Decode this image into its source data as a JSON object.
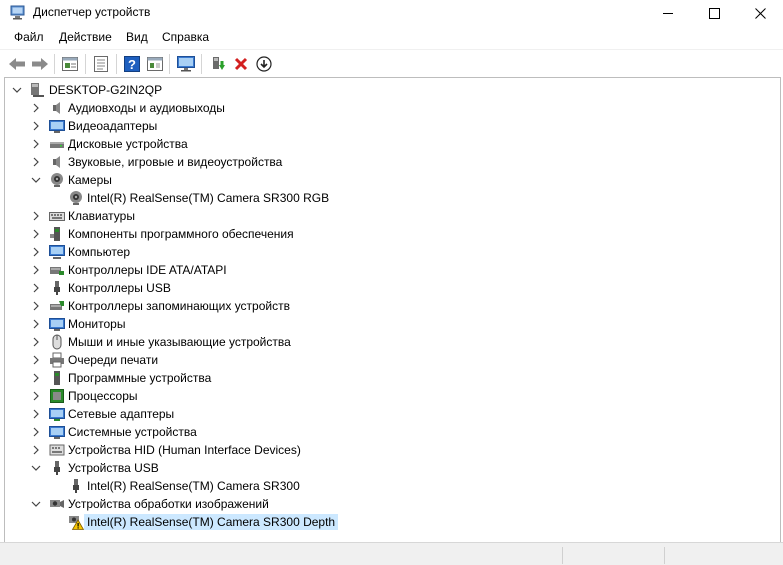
{
  "window": {
    "title": "Диспетчер устройств",
    "icon": "device-manager-icon"
  },
  "menu": [
    "Файл",
    "Действие",
    "Вид",
    "Справка"
  ],
  "toolbar": {
    "buttons": [
      "back-icon",
      "forward-icon",
      "properties-view-icon",
      "document-icon",
      "help-icon",
      "grid-view-icon",
      "monitor-scan-icon",
      "update-driver-icon",
      "uninstall-icon",
      "download-icon"
    ]
  },
  "tree": {
    "root": "DESKTOP-G2IN2QP",
    "items": [
      {
        "label": "Аудиовходы и аудиовыходы",
        "icon": "audio-icon",
        "expanded": false
      },
      {
        "label": "Видеоадаптеры",
        "icon": "display-adapter-icon",
        "expanded": false
      },
      {
        "label": "Дисковые устройства",
        "icon": "disk-icon",
        "expanded": false
      },
      {
        "label": "Звуковые, игровые и видеоустройства",
        "icon": "speaker-icon",
        "expanded": false
      },
      {
        "label": "Камеры",
        "icon": "camera-icon",
        "expanded": true
      },
      {
        "label": "Intel(R) RealSense(TM) Camera SR300 RGB",
        "icon": "camera-icon",
        "child": true
      },
      {
        "label": "Клавиатуры",
        "icon": "keyboard-icon",
        "expanded": false
      },
      {
        "label": "Компоненты программного обеспечения",
        "icon": "software-component-icon",
        "expanded": false
      },
      {
        "label": "Компьютер",
        "icon": "computer-icon",
        "expanded": false
      },
      {
        "label": "Контроллеры IDE ATA/ATAPI",
        "icon": "ide-controller-icon",
        "expanded": false
      },
      {
        "label": "Контроллеры USB",
        "icon": "usb-icon",
        "expanded": false
      },
      {
        "label": "Контроллеры запоминающих устройств",
        "icon": "storage-controller-icon",
        "expanded": false
      },
      {
        "label": "Мониторы",
        "icon": "monitor-icon",
        "expanded": false
      },
      {
        "label": "Мыши и иные указывающие устройства",
        "icon": "mouse-icon",
        "expanded": false
      },
      {
        "label": "Очереди печати",
        "icon": "printer-icon",
        "expanded": false
      },
      {
        "label": "Программные устройства",
        "icon": "software-device-icon",
        "expanded": false
      },
      {
        "label": "Процессоры",
        "icon": "processor-icon",
        "expanded": false
      },
      {
        "label": "Сетевые адаптеры",
        "icon": "network-adapter-icon",
        "expanded": false
      },
      {
        "label": "Системные устройства",
        "icon": "system-device-icon",
        "expanded": false
      },
      {
        "label": "Устройства HID (Human Interface Devices)",
        "icon": "hid-icon",
        "expanded": false
      },
      {
        "label": "Устройства USB",
        "icon": "usb-icon",
        "expanded": true
      },
      {
        "label": "Intel(R) RealSense(TM) Camera SR300",
        "icon": "usb-icon",
        "child": true
      },
      {
        "label": "Устройства обработки изображений",
        "icon": "imaging-device-icon",
        "expanded": true
      },
      {
        "label": "Intel(R) RealSense(TM) Camera SR300 Depth",
        "icon": "warning-device-icon",
        "child": true,
        "selected": true
      }
    ]
  },
  "colors": {
    "selection": "#cce8ff",
    "accent_blue": "#1e6fd9",
    "uninstall_red": "#d32020",
    "warning_yellow": "#f5c400"
  }
}
